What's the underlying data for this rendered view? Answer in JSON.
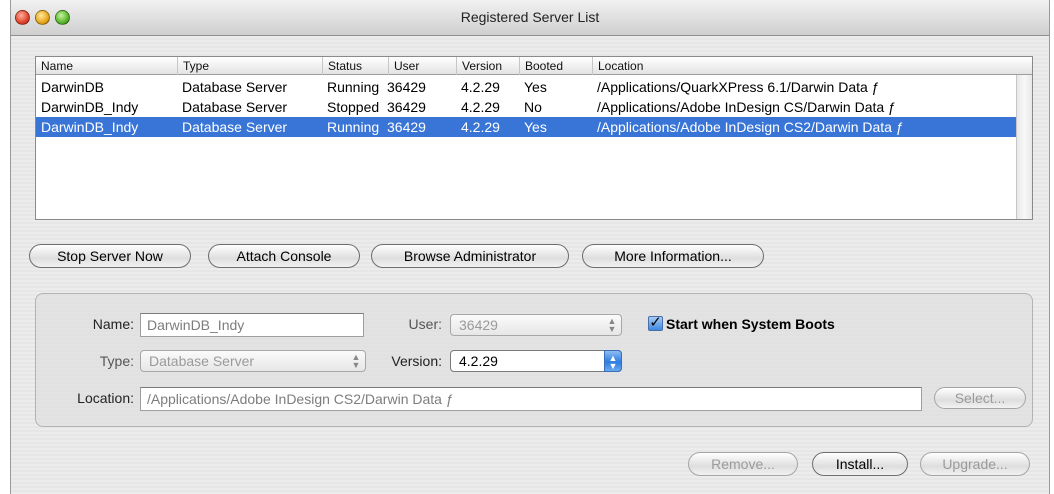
{
  "window": {
    "title": "Registered Server List"
  },
  "table": {
    "columns": [
      "Name",
      "Type",
      "Status",
      "User",
      "Version",
      "Booted",
      "Location"
    ],
    "rows": [
      {
        "name": "DarwinDB",
        "type": "Database Server",
        "status": "Running",
        "user": "36429",
        "version": "4.2.29",
        "booted": "Yes",
        "location": "/Applications/QuarkXPress 6.1/Darwin Data ƒ"
      },
      {
        "name": "DarwinDB_Indy",
        "type": "Database Server",
        "status": "Stopped",
        "user": "36429",
        "version": "4.2.29",
        "booted": "No",
        "location": "/Applications/Adobe InDesign CS/Darwin Data ƒ"
      },
      {
        "name": "DarwinDB_Indy",
        "type": "Database Server",
        "status": "Running",
        "user": "36429",
        "version": "4.2.29",
        "booted": "Yes",
        "location": "/Applications/Adobe InDesign CS2/Darwin Data ƒ",
        "selected": true
      }
    ]
  },
  "actions": {
    "stop_server": "Stop Server Now",
    "attach_console": "Attach Console",
    "browse_admin": "Browse Administrator",
    "more_info": "More Information..."
  },
  "details": {
    "name_label": "Name:",
    "name_value": "DarwinDB_Indy",
    "user_label": "User:",
    "user_value": "36429",
    "start_boot_label": "Start when System Boots",
    "start_boot_checked": true,
    "type_label": "Type:",
    "type_value": "Database Server",
    "version_label": "Version:",
    "version_value": "4.2.29",
    "location_label": "Location:",
    "location_value": "/Applications/Adobe InDesign CS2/Darwin Data ƒ",
    "select_label": "Select..."
  },
  "footer": {
    "remove": "Remove...",
    "install": "Install...",
    "upgrade": "Upgrade..."
  },
  "colors": {
    "selection": "#3875d7",
    "window_bg": "#e9e9e9"
  }
}
